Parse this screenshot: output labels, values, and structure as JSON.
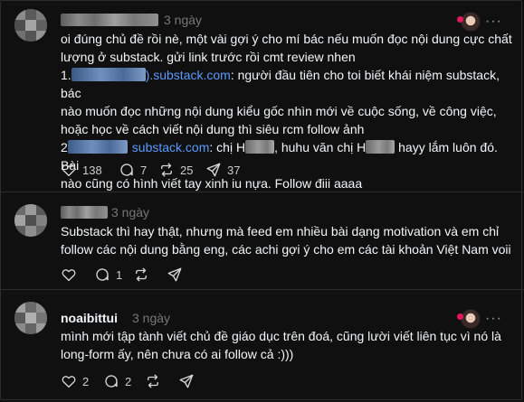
{
  "posts": [
    {
      "username": "",
      "time": "3 ngày",
      "more_icon": "ellipsis-icon",
      "body": {
        "line1": "oi đúng chủ đề rồi nè, một vài gợi ý cho mí bác nếu muốn đọc nội dung cực chất",
        "line2": "lượng ở substack. gửi link trước rồi cmt review nhen",
        "item1_prefix": "1.",
        "item1_link": ").substack.com",
        "item1_text_a": ": người đầu tiên cho toi biết khái niệm substack, bác",
        "item1_text_b": "nào muốn đọc những nội dung kiểu gốc nhìn mới về cuộc sống, về công việc,",
        "item1_text_c": "hoặc học về cách viết nội dung thì siêu rcm follow ảnh",
        "item2_prefix": "2",
        "item2_link": "substack.com",
        "item2_text_a": ": chị H",
        "item2_text_b": ", huhu văn chị H",
        "item2_text_c": " hayy lắm luôn đó. Bài",
        "item2_text_d": "nào cũng có hình viết tay xinh iu nựa. Follow điii aaaa"
      },
      "counts": {
        "likes": "138",
        "replies": "7",
        "reposts": "25",
        "shares": "37"
      }
    },
    {
      "username": "",
      "time": "3 ngày",
      "body": {
        "line1": "Substack thì hay thật, nhưng mà feed em nhiều bài dạng motivation và em chỉ",
        "line2": "follow các nội dung bằng eng, các achi gợi ý cho em các tài khoản Việt Nam voii"
      },
      "counts": {
        "likes": "",
        "replies": "1",
        "reposts": "",
        "shares": ""
      }
    },
    {
      "username": "noaibittui",
      "time": "3 ngày",
      "more_icon": "ellipsis-icon",
      "body": {
        "line1": "mình mới tập tành viết chủ đề giáo dục trên đoá, cũng lười viết liên tục vì nó là",
        "line2": "long-form ấy, nên chưa có ai follow cả :)))"
      },
      "counts": {
        "likes": "2",
        "replies": "2",
        "reposts": "",
        "shares": ""
      }
    }
  ],
  "colors": {
    "background": "#101010",
    "text": "#f3f5f7",
    "muted": "#777777",
    "link": "#5b9bff",
    "divider": "#2d2d2d"
  }
}
